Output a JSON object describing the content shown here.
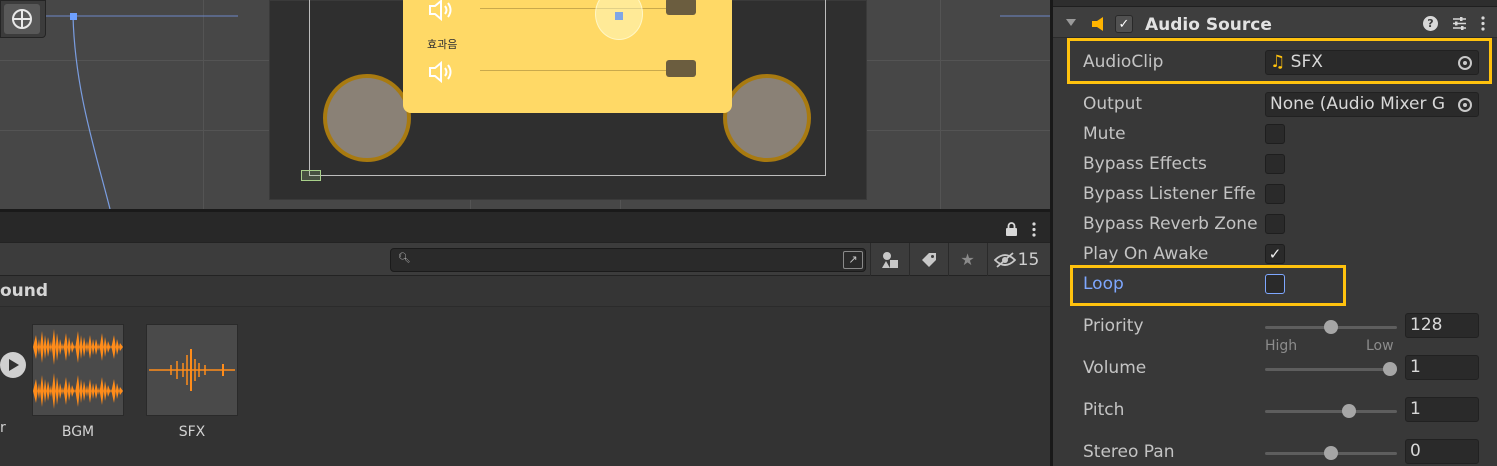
{
  "scene": {
    "panel_label": "효과음"
  },
  "project": {
    "hidden_count": "15",
    "breadcrumb": "ound",
    "assets": [
      {
        "name": "BGM",
        "type": "audio-clip"
      },
      {
        "name": "SFX",
        "type": "audio-clip"
      }
    ],
    "cut_label": "r"
  },
  "inspector": {
    "component_title": "Audio Source",
    "audio_clip": {
      "label": "AudioClip",
      "value": "SFX"
    },
    "output": {
      "label": "Output",
      "value": "None (Audio Mixer G"
    },
    "mute": {
      "label": "Mute",
      "checked": false
    },
    "bypass_effects": {
      "label": "Bypass Effects",
      "checked": false
    },
    "bypass_listener_effects": {
      "label": "Bypass Listener Effe",
      "checked": false
    },
    "bypass_reverb_zones": {
      "label": "Bypass Reverb Zone",
      "checked": false
    },
    "play_on_awake": {
      "label": "Play On Awake",
      "checked": true,
      "mark": "✓"
    },
    "loop": {
      "label": "Loop",
      "checked": false
    },
    "priority": {
      "label": "Priority",
      "value": "128",
      "min_label": "High",
      "max_label": "Low",
      "fraction": 0.5
    },
    "volume": {
      "label": "Volume",
      "value": "1",
      "fraction": 1.0
    },
    "pitch": {
      "label": "Pitch",
      "value": "1",
      "fraction": 0.65
    },
    "stereo_pan": {
      "label": "Stereo Pan",
      "value": "0",
      "fraction": 0.5
    }
  },
  "colors": {
    "highlight": "#ffc20e",
    "accent_blue": "#7ea7ff",
    "waveform": "#ff8c1a",
    "panel_yellow": "#ffd966"
  }
}
